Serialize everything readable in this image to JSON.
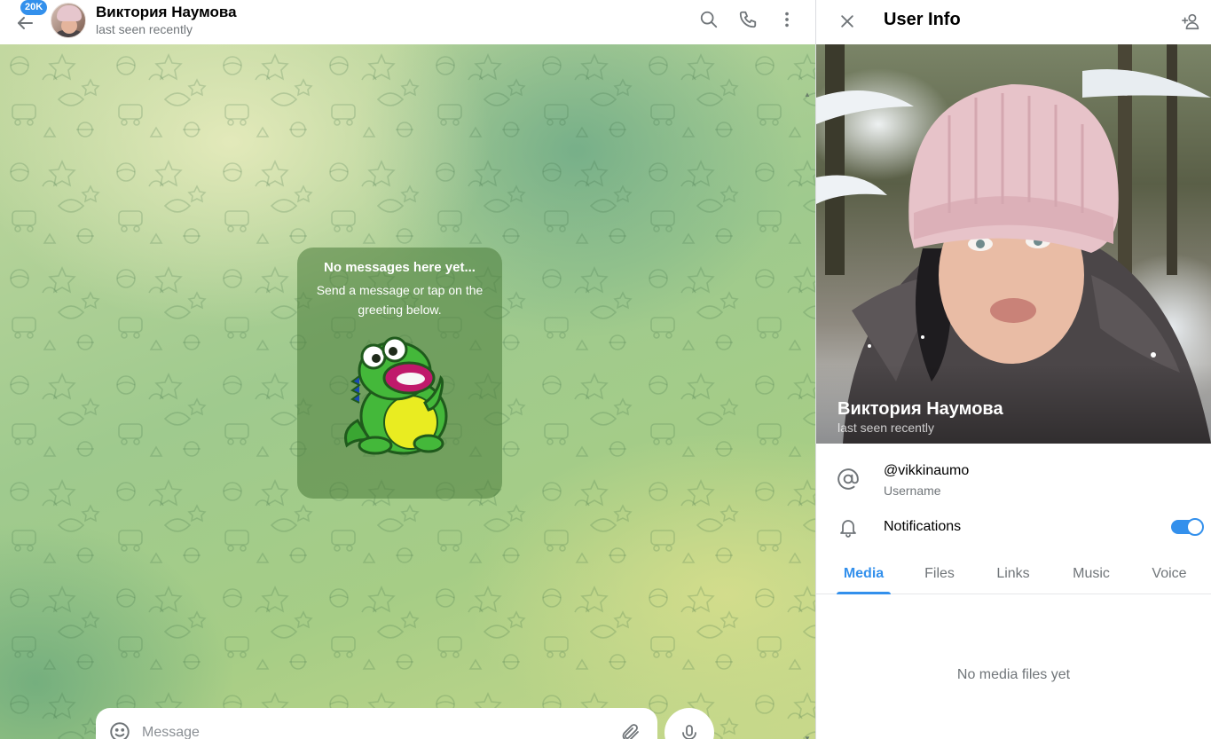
{
  "chat": {
    "header": {
      "title": "Виктория Наумова",
      "status": "last seen recently",
      "unread_badge": "20K"
    },
    "empty_state": {
      "title": "No messages here yet...",
      "subtitle": "Send a message or tap on the greeting below."
    },
    "composer": {
      "placeholder": "Message"
    }
  },
  "user_info": {
    "title": "User Info",
    "profile": {
      "name": "Виктория Наумова",
      "status": "last seen recently"
    },
    "username": {
      "value": "@vikkinaumo",
      "label": "Username"
    },
    "notifications": {
      "label": "Notifications",
      "enabled": true
    },
    "tabs": [
      "Media",
      "Files",
      "Links",
      "Music",
      "Voice"
    ],
    "active_tab": "Media",
    "empty_media": "No media files yet"
  },
  "icons": {
    "header": [
      "arrow-left-icon",
      "search-icon",
      "phone-icon",
      "more-vertical-icon"
    ],
    "info": [
      "close-icon",
      "add-contact-icon",
      "at-sign-icon",
      "bell-icon"
    ],
    "composer": [
      "smile-icon",
      "paperclip-icon",
      "microphone-icon"
    ]
  },
  "colors": {
    "accent": "#3390ec",
    "secondary_text": "#707579",
    "card_overlay": "#4a7c3a"
  }
}
